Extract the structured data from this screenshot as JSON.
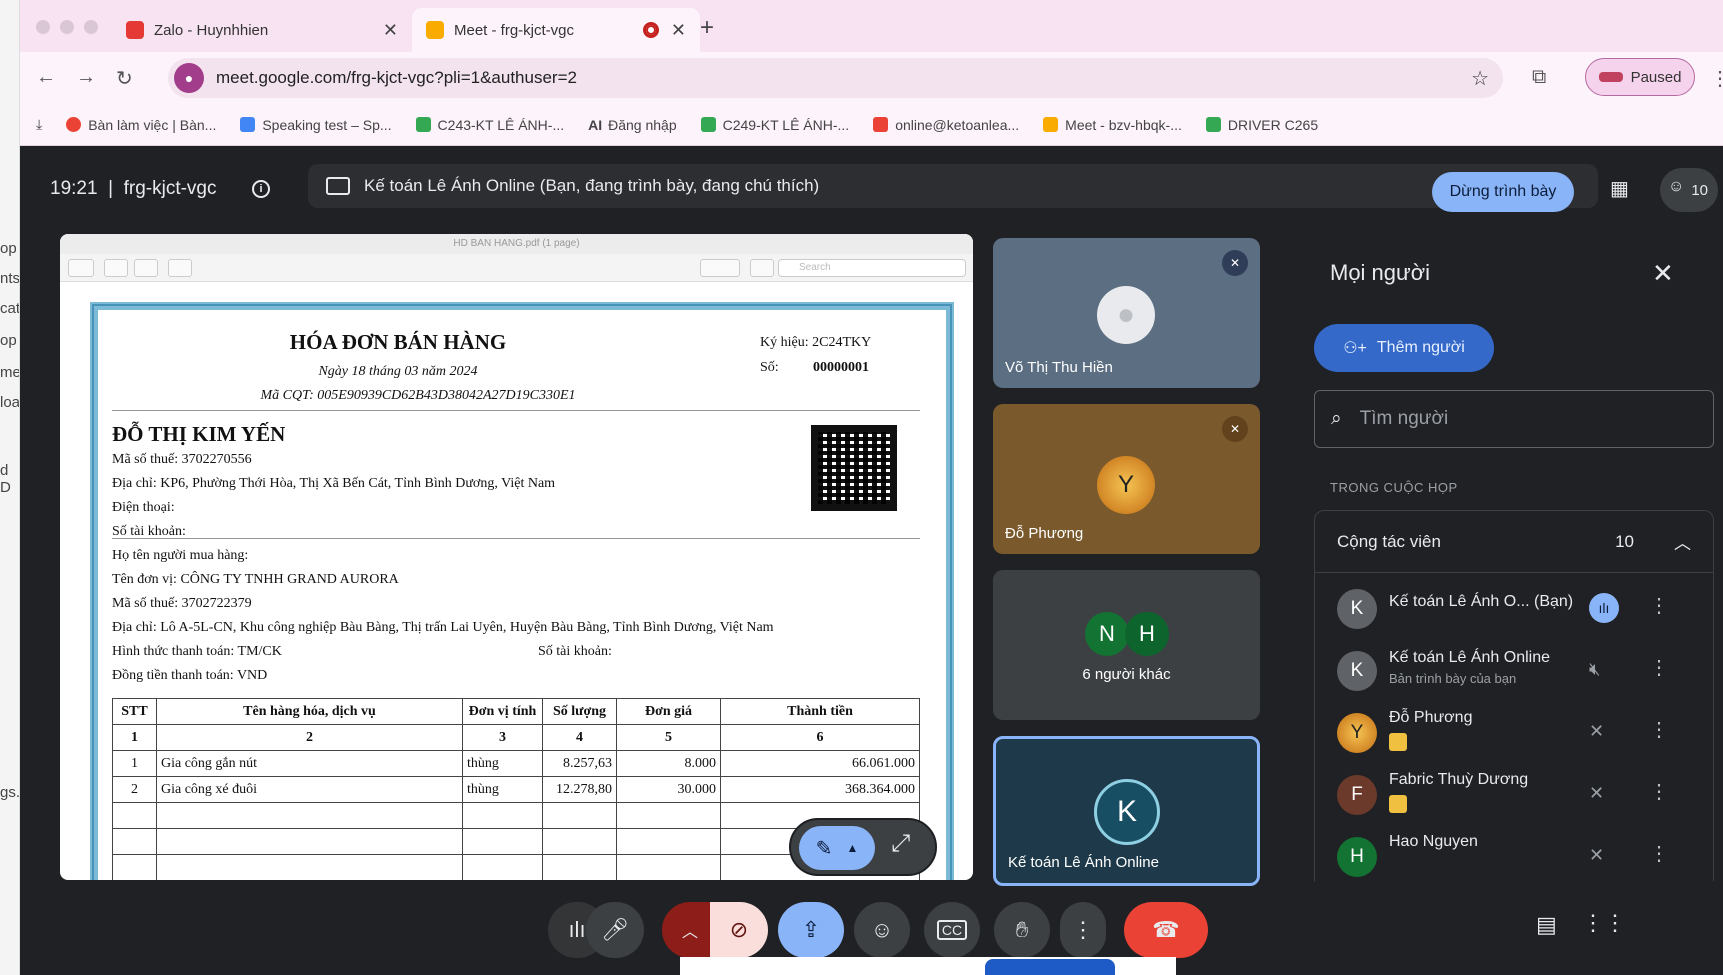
{
  "browser": {
    "tabs": [
      {
        "title": "Zalo - Huynhhien",
        "favicon_color": "#e53935",
        "active": false
      },
      {
        "title": "Meet - frg-kjct-vgc",
        "favicon_color": "#f9ab00",
        "active": true
      }
    ],
    "url": "meet.google.com/frg-kjct-vgc?pli=1&authuser=2",
    "profile_status": "Paused",
    "bookmarks": [
      {
        "label": "Bàn làm việc | Bàn...",
        "icon": "chrome-icon"
      },
      {
        "label": "Speaking test – Sp...",
        "icon": "doc-icon"
      },
      {
        "label": "C243-KT LÊ ÁNH-...",
        "icon": "drive-icon"
      },
      {
        "label": "Đăng nhập",
        "icon": "ai-icon"
      },
      {
        "label": "C249-KT LÊ ÁNH-...",
        "icon": "drive-icon"
      },
      {
        "label": "online@ketoanlea...",
        "icon": "gmail-icon"
      },
      {
        "label": "Meet - bzv-hbqk-...",
        "icon": "meet-icon"
      },
      {
        "label": "DRIVER C265",
        "icon": "drive-icon"
      }
    ],
    "bookmark_prefix": "AI"
  },
  "meet": {
    "time": "19:21",
    "meeting_code": "frg-kjct-vgc",
    "presenting_banner": "Kế toán Lê Ánh Online (Bạn, đang trình bày, đang chú thích)",
    "stop_presenting_label": "Dừng trình bày",
    "participant_count": "10"
  },
  "viewer": {
    "window_title": "HD BAN HANG.pdf (1 page)",
    "search_placeholder": "Search"
  },
  "invoice": {
    "title": "HÓA ĐƠN BÁN HÀNG",
    "date": "Ngày 18 tháng 03 năm 2024",
    "cqt": "Mã CQT: 005E90939CD62B43D38042A27D19C330E1",
    "ky_hieu": "Ký hiệu: 2C24TKY",
    "so_label": "Số:",
    "so_value": "00000001",
    "seller_name": "ĐỖ THỊ KIM YẾN",
    "seller_tax": "Mã số thuế: 3702270556",
    "seller_address": "Địa chỉ: KP6, Phường Thới Hòa, Thị Xã Bến Cát, Tỉnh Bình Dương, Việt Nam",
    "seller_phone": "Điện thoại:",
    "seller_account": "Số tài khoản:",
    "buyer_name": "Họ tên người mua hàng:",
    "buyer_unit": "Tên đơn vị: CÔNG TY TNHH GRAND AURORA",
    "buyer_tax": "Mã số thuế: 3702722379",
    "buyer_address": "Địa chỉ: Lô A-5L-CN, Khu công nghiệp Bàu Bàng, Thị trấn Lai Uyên, Huyện Bàu Bàng, Tỉnh Bình Dương, Việt Nam",
    "payment": "Hình thức thanh toán: TM/CK",
    "buyer_account": "Số tài khoản:",
    "currency": "Đồng tiền thanh toán: VND",
    "headers": [
      "STT",
      "Tên hàng hóa, dịch vụ",
      "Đơn vị tính",
      "Số lượng",
      "Đơn giá",
      "Thành tiền"
    ],
    "index_row": [
      "1",
      "2",
      "3",
      "4",
      "5",
      "6"
    ],
    "rows": [
      [
        "1",
        "Gia công gắn nút",
        "thùng",
        "8.257,63",
        "8.000",
        "66.061.000"
      ],
      [
        "2",
        "Gia công xé đuôi",
        "thùng",
        "12.278,80",
        "30.000",
        "368.364.000"
      ]
    ]
  },
  "tiles": [
    {
      "name": "Võ Thị Thu Hiền"
    },
    {
      "name": "Đỗ Phương"
    },
    {
      "name": "6 người khác",
      "avatars": [
        "N",
        "H"
      ]
    },
    {
      "name": "Kế toán Lê Ánh Online",
      "avatar": "K"
    }
  ],
  "people_panel": {
    "title": "Mọi người",
    "add_label": "Thêm người",
    "search_placeholder": "Tìm người",
    "section_label": "TRONG CUỘC HỌP",
    "group_label": "Cộng tác viên",
    "group_count": "10",
    "people": [
      {
        "initial": "K",
        "name": "Kế toán Lê Ánh O...",
        "suffix": "(Bạn)",
        "sub": ""
      },
      {
        "initial": "K",
        "name": "Kế toán Lê Ánh Online",
        "suffix": "",
        "sub": "Bản trình bày của bạn"
      },
      {
        "initial": "",
        "name": "Đỗ Phương",
        "suffix": "",
        "sub": ""
      },
      {
        "initial": "F",
        "name": "Fabric Thuỳ Dương",
        "suffix": "",
        "sub": ""
      },
      {
        "initial": "H",
        "name": "Hao Nguyen",
        "suffix": "",
        "sub": ""
      }
    ]
  },
  "left_strip": [
    "op",
    "nts",
    "cat",
    "op",
    "me",
    "loa",
    "d D",
    "gs."
  ]
}
